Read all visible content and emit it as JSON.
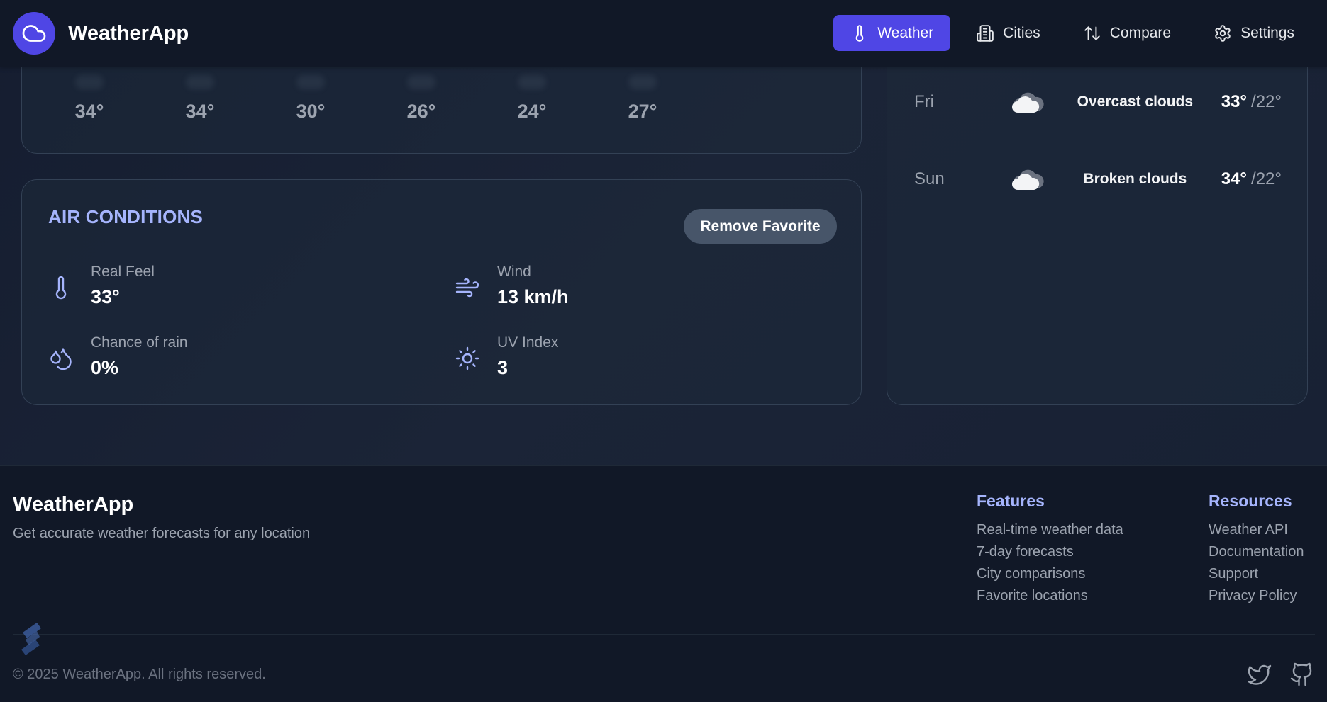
{
  "header": {
    "brand": "WeatherApp",
    "nav": [
      {
        "label": "Weather",
        "icon": "thermometer-icon",
        "active": true
      },
      {
        "label": "Cities",
        "icon": "building-icon",
        "active": false
      },
      {
        "label": "Compare",
        "icon": "arrows-up-down-icon",
        "active": false
      },
      {
        "label": "Settings",
        "icon": "gear-icon",
        "active": false
      }
    ]
  },
  "hourly": {
    "temps": [
      "34°",
      "34°",
      "30°",
      "26°",
      "24°",
      "27°"
    ]
  },
  "air_conditions": {
    "title": "AIR CONDITIONS",
    "remove_favorite": "Remove Favorite",
    "metrics": [
      {
        "label": "Real Feel",
        "value": "33°",
        "icon": "thermometer-icon"
      },
      {
        "label": "Wind",
        "value": "13 km/h",
        "icon": "wind-icon"
      },
      {
        "label": "Chance of rain",
        "value": "0%",
        "icon": "droplets-icon"
      },
      {
        "label": "UV Index",
        "value": "3",
        "icon": "sun-icon"
      }
    ]
  },
  "forecast": [
    {
      "day": "Fri",
      "desc": "Overcast clouds",
      "high": "33°",
      "low": "/22°",
      "icon": "cloud-icon"
    },
    {
      "day": "Sun",
      "desc": "Broken clouds",
      "high": "34°",
      "low": "/22°",
      "icon": "cloud-icon"
    }
  ],
  "footer": {
    "brand": "WeatherApp",
    "tagline": "Get accurate weather forecasts for any location",
    "features": {
      "title": "Features",
      "links": [
        "Real-time weather data",
        "7-day forecasts",
        "City comparisons",
        "Favorite locations"
      ]
    },
    "resources": {
      "title": "Resources",
      "links": [
        "Weather API",
        "Documentation",
        "Support",
        "Privacy Policy"
      ]
    },
    "copyright": "© 2025 WeatherApp. All rights reserved.",
    "social": [
      "twitter-icon",
      "github-icon"
    ]
  },
  "colors": {
    "accent": "#4f46e5",
    "accent_light": "#a5b4fc",
    "background": "#172033",
    "header_bg": "#111827"
  }
}
